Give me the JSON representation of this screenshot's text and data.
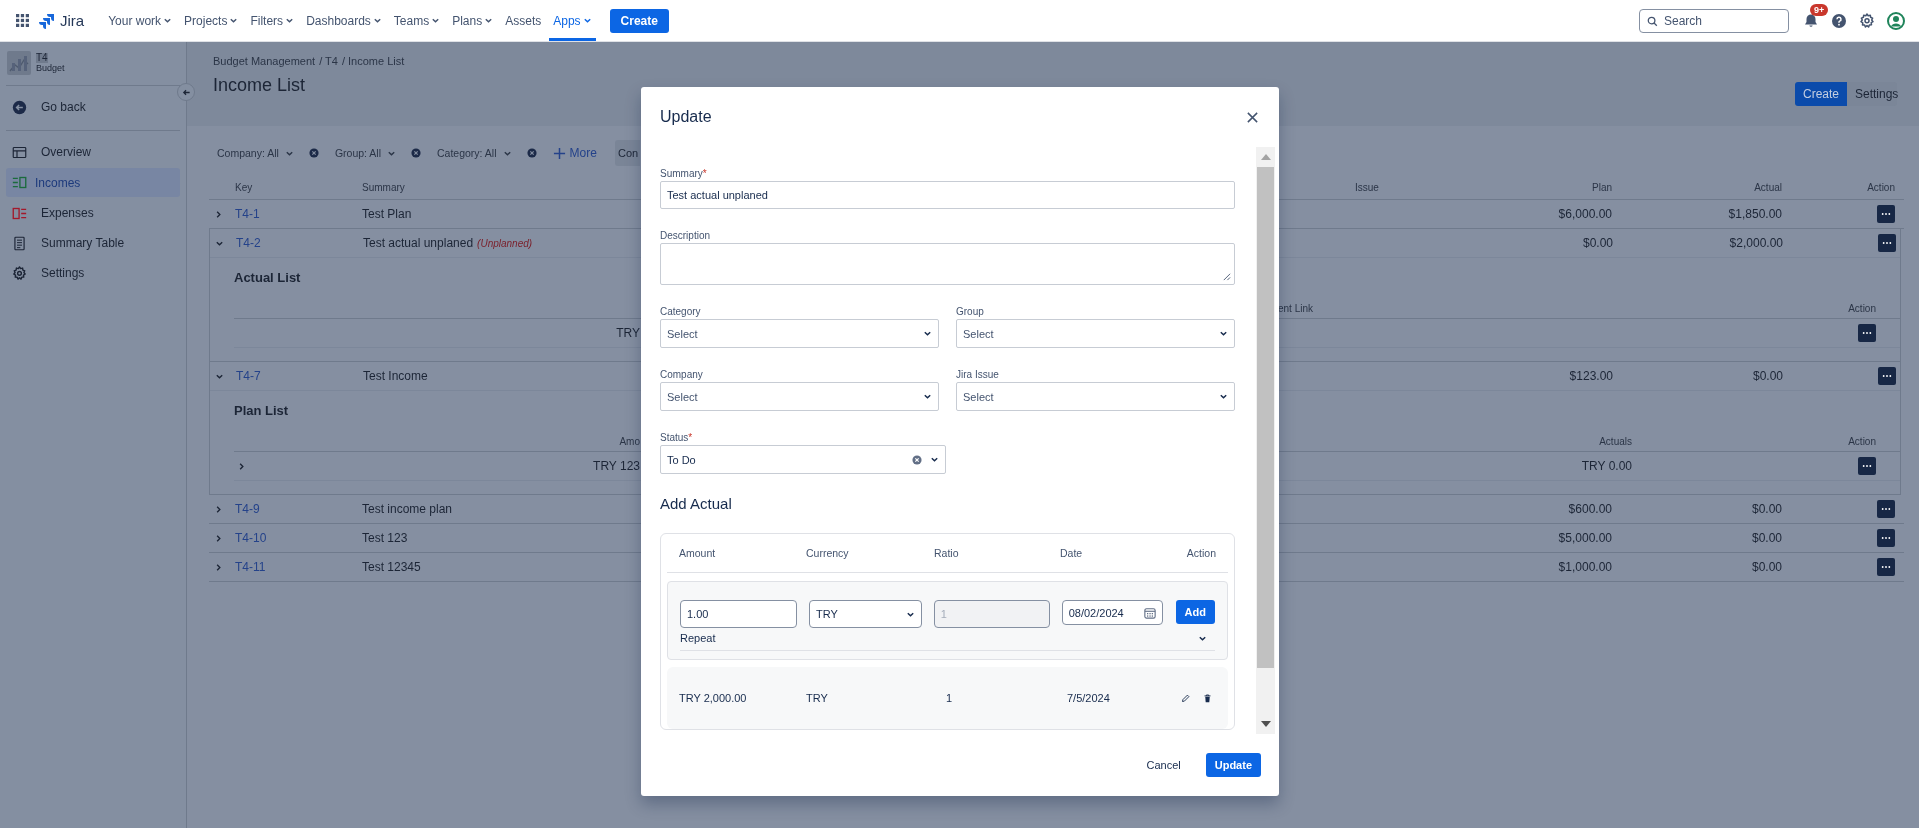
{
  "topnav": {
    "logo": "Jira",
    "items": [
      {
        "label": "Your work",
        "dropdown": true,
        "selected": false
      },
      {
        "label": "Projects",
        "dropdown": true,
        "selected": false
      },
      {
        "label": "Filters",
        "dropdown": true,
        "selected": false
      },
      {
        "label": "Dashboards",
        "dropdown": true,
        "selected": false
      },
      {
        "label": "Teams",
        "dropdown": true,
        "selected": false
      },
      {
        "label": "Plans",
        "dropdown": true,
        "selected": false
      },
      {
        "label": "Assets",
        "dropdown": false,
        "selected": false
      },
      {
        "label": "Apps",
        "dropdown": true,
        "selected": true
      }
    ],
    "create": "Create",
    "search": {
      "placeholder": "Search"
    },
    "notifications": "9+"
  },
  "sidebar": {
    "project": {
      "name": "T4",
      "type": "Budget"
    },
    "back": "Go back",
    "items": [
      {
        "label": "Overview",
        "kind": "overview",
        "selected": false
      },
      {
        "label": "Incomes",
        "kind": "incomes",
        "selected": true
      },
      {
        "label": "Expenses",
        "kind": "expenses",
        "selected": false
      },
      {
        "label": "Summary Table",
        "kind": "table",
        "selected": false
      },
      {
        "label": "Settings",
        "kind": "settings",
        "selected": false
      }
    ]
  },
  "header": {
    "breadcrumbs": [
      "Budget Management",
      "/ T4",
      "/ Income List"
    ],
    "title": "Income List",
    "buttons": [
      {
        "label": "Create",
        "kind": "primary"
      },
      {
        "label": "Settings",
        "kind": "subtle"
      }
    ]
  },
  "filters": {
    "items": [
      {
        "label": "Company: All"
      },
      {
        "label": "Group: All"
      },
      {
        "label": "Category: All"
      }
    ],
    "more": "More",
    "cut_button": "Con"
  },
  "table": {
    "columns": {
      "key": "Key",
      "summary": "Summary",
      "issue": "Issue",
      "plan": "Plan",
      "actual": "Actual",
      "action": "Action"
    },
    "rows": [
      {
        "key": "T4-1",
        "summary": "Test Plan",
        "plan": "$6,000.00",
        "actual": "$1,850.00",
        "expanded": false
      },
      {
        "key": "T4-2",
        "summary": "Test actual unplaned",
        "tag": "(Unplanned)",
        "plan": "$0.00",
        "actual": "$2,000.00",
        "expanded": true,
        "detail": {
          "kind": "actual",
          "title": "Actual List",
          "header_right": "ent Link",
          "header_action": "Action",
          "row_left": "TRY"
        }
      },
      {
        "key": "T4-7",
        "summary": "Test Income",
        "plan": "$123.00",
        "actual": "$0.00",
        "expanded": true,
        "detail": {
          "kind": "plan",
          "title": "Plan List",
          "header_left": "Amo",
          "header_mid": "Actuals",
          "header_action": "Action",
          "row_left": "TRY 123",
          "row_mid": "TRY 0.00"
        }
      },
      {
        "key": "T4-9",
        "summary": "Test income plan",
        "plan": "$600.00",
        "actual": "$0.00",
        "expanded": false
      },
      {
        "key": "T4-10",
        "summary": "Test 123",
        "plan": "$5,000.00",
        "actual": "$0.00",
        "expanded": false
      },
      {
        "key": "T4-11",
        "summary": "Test 12345",
        "plan": "$1,000.00",
        "actual": "$0.00",
        "expanded": false
      }
    ]
  },
  "modal": {
    "title": "Update",
    "fields": [
      {
        "label": "Summary",
        "required_mark": "*",
        "kind": "text",
        "value": "Test actual unplaned"
      },
      {
        "label": "Description",
        "kind": "textarea"
      },
      {
        "label": "Category",
        "kind": "select",
        "placeholder": "Select"
      },
      {
        "label": "Group",
        "kind": "select",
        "placeholder": "Select"
      },
      {
        "label": "Company",
        "kind": "select",
        "placeholder": "Select"
      },
      {
        "label": "Jira Issue",
        "kind": "select",
        "placeholder": "Select"
      },
      {
        "label": "Status",
        "required_mark": "*",
        "kind": "select",
        "value": "To Do",
        "clearable": true
      }
    ],
    "section": "Add Actual",
    "actual_table": {
      "columns": [
        "Amount",
        "Currency",
        "Ratio",
        "Date",
        "Action"
      ],
      "new_row": {
        "amount": "1.00",
        "currency": "TRY",
        "ratio": "1",
        "ratio_disabled": true,
        "date": "08/02/2024",
        "add": "Add",
        "repeat": "Repeat"
      },
      "rows": [
        {
          "amount": "TRY 2,000.00",
          "currency": "TRY",
          "ratio": "1",
          "date": "7/5/2024"
        }
      ]
    },
    "buttons": [
      {
        "label": "Cancel",
        "kind": "subtle"
      },
      {
        "label": "Update",
        "kind": "primary"
      }
    ]
  }
}
